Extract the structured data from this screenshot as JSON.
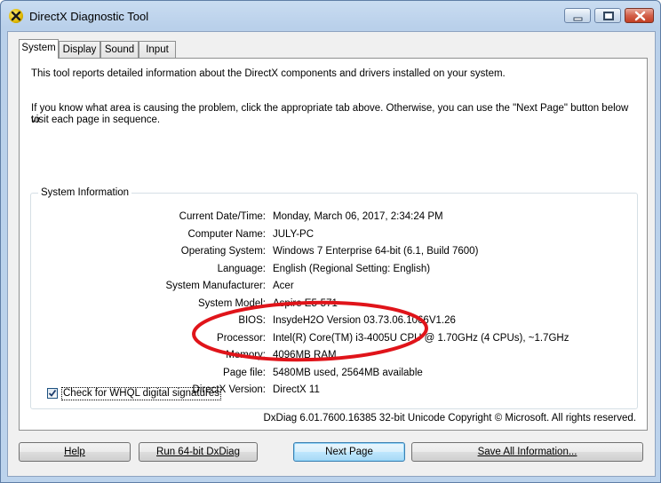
{
  "window": {
    "title": "DirectX Diagnostic Tool"
  },
  "tabs": [
    {
      "label": "System",
      "active": true
    },
    {
      "label": "Display",
      "active": false
    },
    {
      "label": "Sound",
      "active": false
    },
    {
      "label": "Input",
      "active": false
    }
  ],
  "intro": {
    "line1": "This tool reports detailed information about the DirectX components and drivers installed on your system.",
    "line2a": "If you know what area is causing the problem, click the appropriate tab above.  Otherwise, you can use the \"Next Page\" button below to",
    "line2b": "visit each page in sequence."
  },
  "system_info": {
    "group_title": "System Information",
    "rows": [
      {
        "label": "Current Date/Time:",
        "value": "Monday, March 06, 2017, 2:34:24 PM"
      },
      {
        "label": "Computer Name:",
        "value": "JULY-PC"
      },
      {
        "label": "Operating System:",
        "value": "Windows 7 Enterprise 64-bit (6.1, Build 7600)"
      },
      {
        "label": "Language:",
        "value": "English (Regional Setting: English)"
      },
      {
        "label": "System Manufacturer:",
        "value": "Acer"
      },
      {
        "label": "System Model:",
        "value": "Aspire E5-571"
      },
      {
        "label": "BIOS:",
        "value": "InsydeH2O Version 03.73.06.1066V1.26"
      },
      {
        "label": "Processor:",
        "value": "Intel(R) Core(TM) i3-4005U CPU @ 1.70GHz (4 CPUs), ~1.7GHz"
      },
      {
        "label": "Memory:",
        "value": "4096MB RAM"
      },
      {
        "label": "Page file:",
        "value": "5480MB used, 2564MB available"
      },
      {
        "label": "DirectX Version:",
        "value": "DirectX 11"
      }
    ]
  },
  "whql": {
    "label": "Check for WHQL digital signatures",
    "checked": true
  },
  "footer": {
    "text": "DxDiag 6.01.7600.16385 32-bit Unicode  Copyright © Microsoft. All rights reserved."
  },
  "buttons": {
    "help": "Help",
    "run64": "Run 64-bit DxDiag",
    "next": "Next Page",
    "save": "Save All Information..."
  },
  "colors": {
    "annotation": "#e0141a",
    "checkmark": "#1c3c6b"
  }
}
